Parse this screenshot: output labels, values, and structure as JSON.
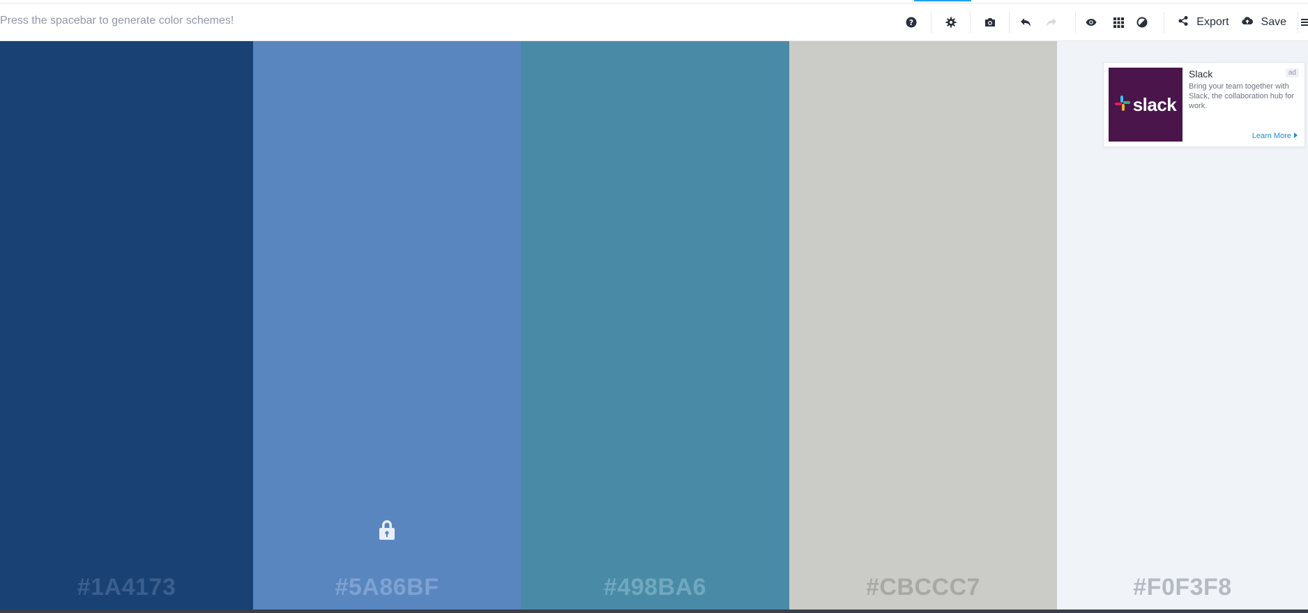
{
  "toolbar": {
    "hint": "Press the spacebar to generate color schemes!",
    "export_label": "Export",
    "save_label": "Save",
    "icons": [
      "help-icon",
      "settings-icon",
      "camera-icon",
      "undo-icon",
      "redo-icon",
      "view-icon",
      "grid-icon",
      "contrast-icon",
      "share-icon",
      "cloud-upload-icon",
      "menu-icon"
    ]
  },
  "palette": {
    "swatches": [
      {
        "hex": "#1A4173",
        "color": "#1A4173",
        "text_color": "#3a5f8f",
        "locked": false
      },
      {
        "hex": "#5A86BF",
        "color": "#5A86BF",
        "text_color": "#7ea2d2",
        "locked": true
      },
      {
        "hex": "#498BA6",
        "color": "#498BA6",
        "text_color": "#72a8bf",
        "locked": false
      },
      {
        "hex": "#CBCCC7",
        "color": "#CBCCC7",
        "text_color": "#a8a9a4",
        "locked": false
      },
      {
        "hex": "#F0F3F8",
        "color": "#F0F3F8",
        "text_color": "#b4bac4",
        "locked": false
      }
    ]
  },
  "ad": {
    "logo_text": "slack",
    "title": "Slack",
    "badge": "ad",
    "body": "Bring your team together with Slack, the collaboration hub for work.",
    "link": "Learn More"
  }
}
